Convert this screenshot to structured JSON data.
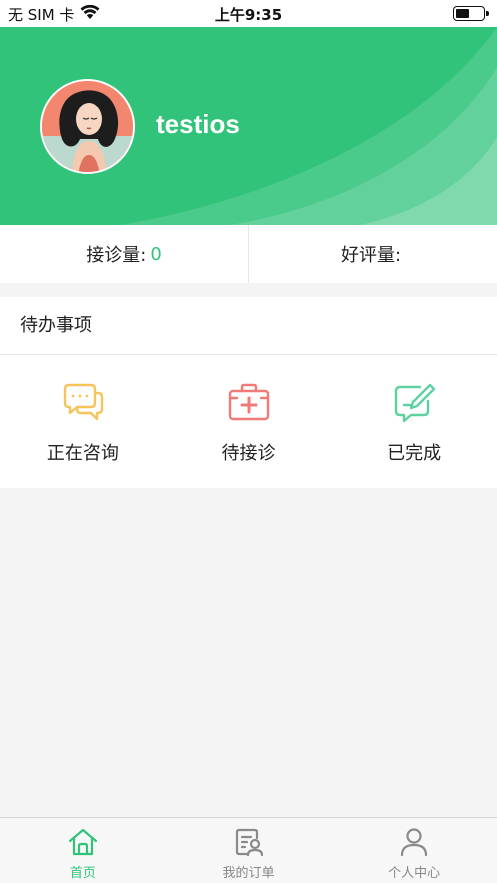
{
  "status_bar": {
    "carrier": "无 SIM 卡",
    "time": "上午9:35",
    "wifi_icon": "wifi-icon",
    "battery_icon": "battery-icon"
  },
  "profile": {
    "username": "testios",
    "avatar": "avatar-illustration"
  },
  "stats": {
    "consultations_label": "接诊量:",
    "consultations_value": "0",
    "rating_label": "好评量:",
    "rating_value": ""
  },
  "todo": {
    "title": "待办事项",
    "items": [
      {
        "label": "正在咨询",
        "icon": "chat-bubbles-icon",
        "color": "#f5c45a"
      },
      {
        "label": "待接诊",
        "icon": "medical-kit-icon",
        "color": "#f07a78"
      },
      {
        "label": "已完成",
        "icon": "edit-check-icon",
        "color": "#5ed1a0"
      }
    ]
  },
  "tabbar": {
    "items": [
      {
        "label": "首页",
        "icon": "home-icon",
        "active": true
      },
      {
        "label": "我的订单",
        "icon": "orders-icon",
        "active": false
      },
      {
        "label": "个人中心",
        "icon": "user-icon",
        "active": false
      }
    ]
  },
  "colors": {
    "brand": "#32c37b",
    "background": "#f4f4f4"
  }
}
